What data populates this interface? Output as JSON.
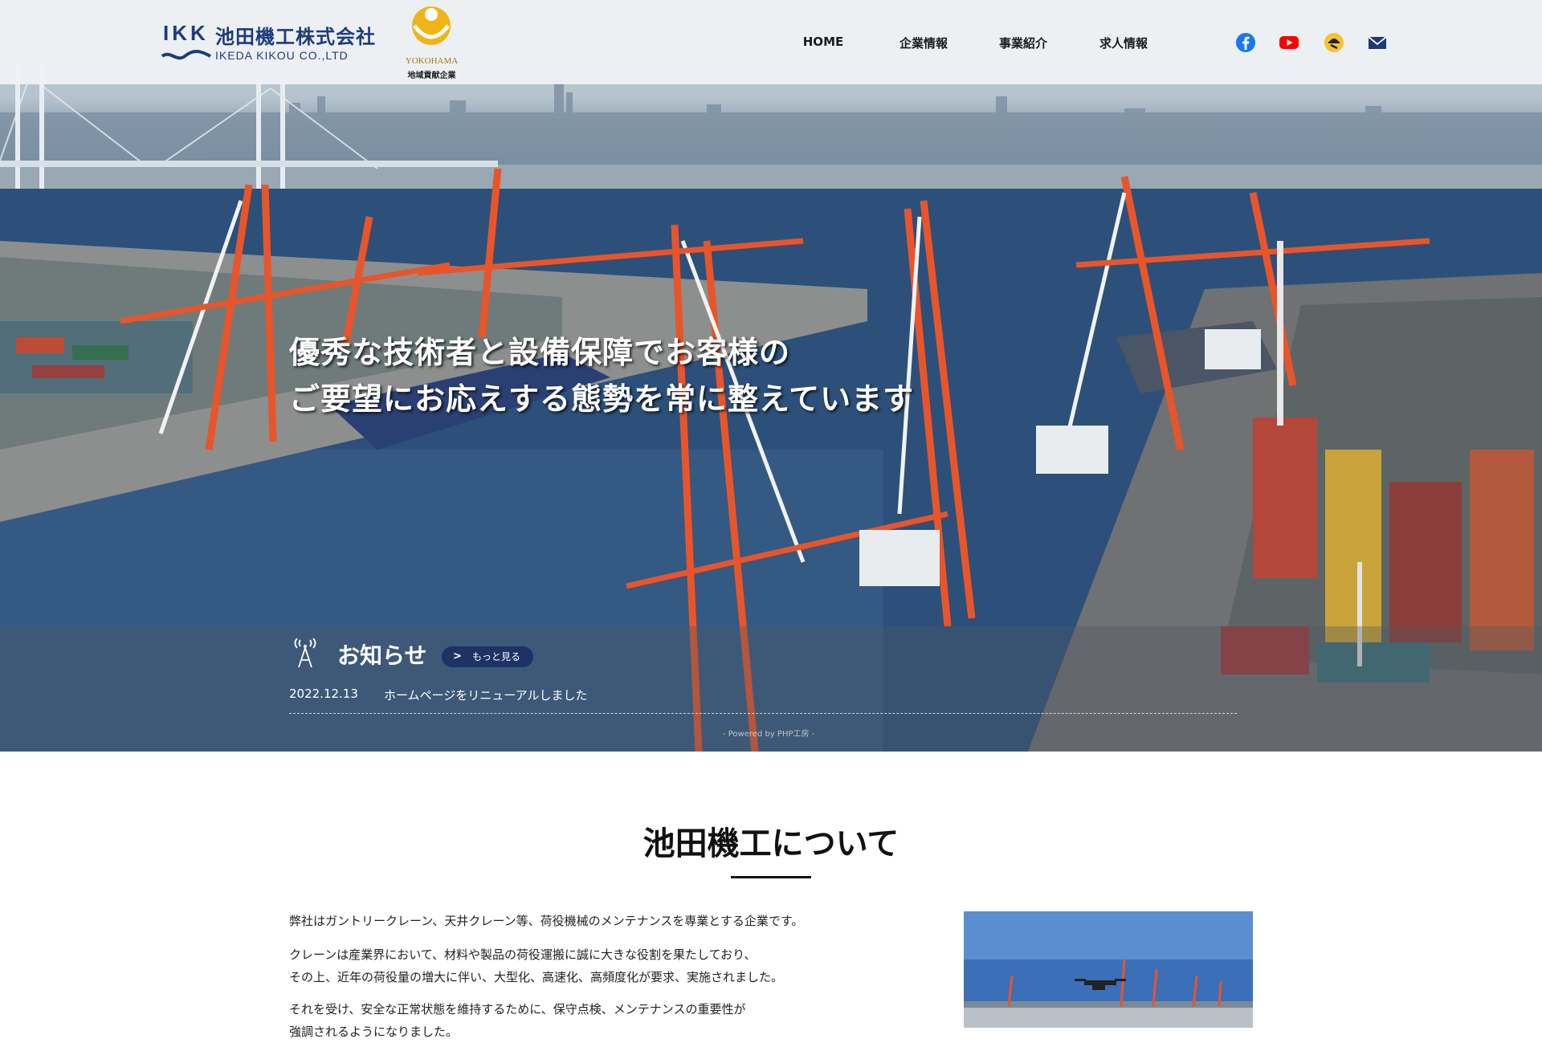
{
  "header": {
    "logo_mark": "IKK",
    "company_name": "池田機工株式会社",
    "company_name_en": "IKEDA KIKOU CO.,LTD",
    "badge_en": "YOKOHAMA",
    "badge_jp": "地域貢献企業"
  },
  "nav": {
    "items": [
      {
        "label": "HOME"
      },
      {
        "label": "企業情報"
      },
      {
        "label": "事業紹介"
      },
      {
        "label": "求人情報"
      }
    ],
    "social": [
      {
        "icon": "facebook-icon",
        "color": "#1877f2"
      },
      {
        "icon": "youtube-icon",
        "color": "#ff0000"
      },
      {
        "icon": "worker-icon",
        "color": "#f4c430"
      },
      {
        "icon": "mail-icon",
        "color": "#1e3a6e"
      }
    ]
  },
  "hero": {
    "headline_line1": "優秀な技術者と設備保障でお客様の",
    "headline_line2": "ご要望にお応えする態勢を常に整えています"
  },
  "news": {
    "title": "お知らせ",
    "more_label": "もっと見る",
    "items": [
      {
        "date": "2022.12.13",
        "text": "ホームページをリニューアルしました"
      }
    ],
    "powered_by": "- Powered by PHP工房 -"
  },
  "about": {
    "title": "池田機工について",
    "para1": "弊社はガントリークレーン、天井クレーン等、荷役機械のメンテナンスを専業とする企業です。",
    "para2_line1": "クレーンは産業界において、材料や製品の荷役運搬に誠に大きな役割を果たしており、",
    "para2_line2": "その上、近年の荷役量の増大に伴い、大型化、高速化、高頻度化が要求、実施されました。",
    "para3_line1": "それを受け、安全な正常状態を維持するために、保守点検、メンテナンスの重要性が",
    "para3_line2": "強調されるようになりました。"
  },
  "colors": {
    "brand_navy": "#1f3c7a",
    "button_navy": "#1e3263",
    "crane_orange": "#e8552a"
  }
}
